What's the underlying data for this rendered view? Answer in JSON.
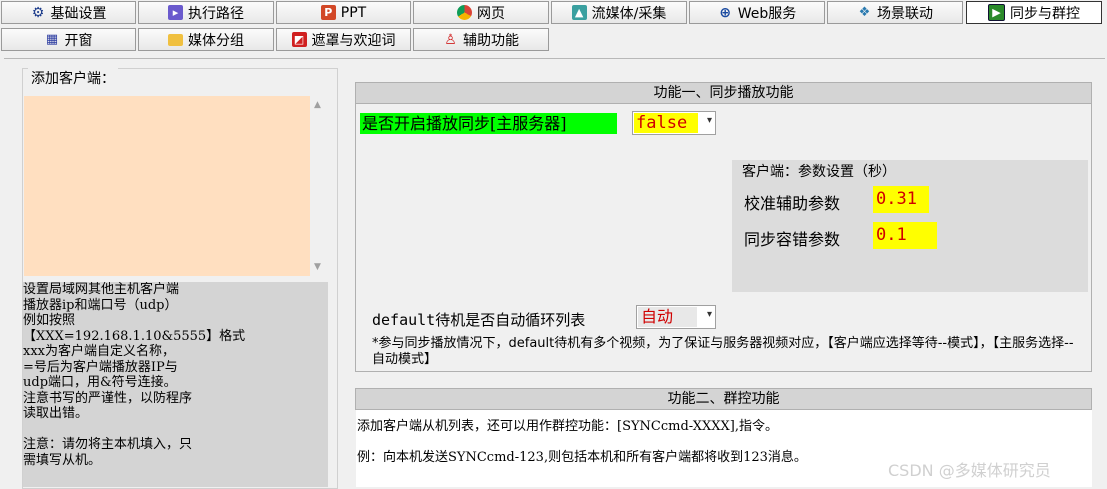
{
  "tabs_row1": [
    {
      "label": "基础设置",
      "icon": "gear-icon"
    },
    {
      "label": "执行路径",
      "icon": "path-icon"
    },
    {
      "label": "PPT",
      "icon": "ppt-icon"
    },
    {
      "label": "网页",
      "icon": "chrome-icon"
    },
    {
      "label": "流媒体/采集",
      "icon": "stream-icon"
    },
    {
      "label": "Web服务",
      "icon": "globe-icon"
    },
    {
      "label": "场景联动",
      "icon": "scene-icon"
    },
    {
      "label": "同步与群控",
      "icon": "sync-icon",
      "active": true
    }
  ],
  "tabs_row2": [
    {
      "label": "开窗",
      "icon": "grid-icon"
    },
    {
      "label": "媒体分组",
      "icon": "folder-icon"
    },
    {
      "label": "遮罩与欢迎词",
      "icon": "mask-icon"
    },
    {
      "label": "辅助功能",
      "icon": "assist-icon"
    }
  ],
  "client_group": {
    "title": "添加客户端：",
    "notes": "设置局域网其他主机客户端\n播放器ip和端口号（udp）\n例如按照\n【XXX=192.168.1.10&5555】格式\nxxx为客户端自定义名称，\n=号后为客户端播放器IP与\nudp端口，用&符号连接。\n注意书写的严谨性，以防程序\n读取出错。\n\n注意：请勿将主本机填入，只\n需填写从机。"
  },
  "section1": {
    "title": "功能一、同步播放功能",
    "sync_label": "是否开启播放同步[主服务器]",
    "sync_value": "false",
    "param_title": "客户端：参数设置（秒）",
    "calib_label": "校准辅助参数",
    "calib_value": "0.31",
    "tolerance_label": "同步容错参数",
    "tolerance_value": "0.1",
    "default_label": "default待机是否自动循环列表",
    "default_value": "自动",
    "info": "*参与同步播放情况下，default待机有多个视频，为了保证与服务器视频对应，【客户端应选择等待--模式】，【主服务选择--自动模式】"
  },
  "section2": {
    "title": "功能二、群控功能",
    "line1": "添加客户端从机列表，还可以用作群控功能：[SYNCcmd-XXXX],指令。",
    "line2": "例：向本机发送SYNCcmd-123,则包括本机和所有客户端都将收到123消息。"
  },
  "watermark": "CSDN @多媒体研究员",
  "colors": {
    "sync_label_bg": "#00ff00",
    "value_bg": "#ffff00",
    "value_text": "#d00000",
    "textarea_bg": "#ffdfc0"
  }
}
